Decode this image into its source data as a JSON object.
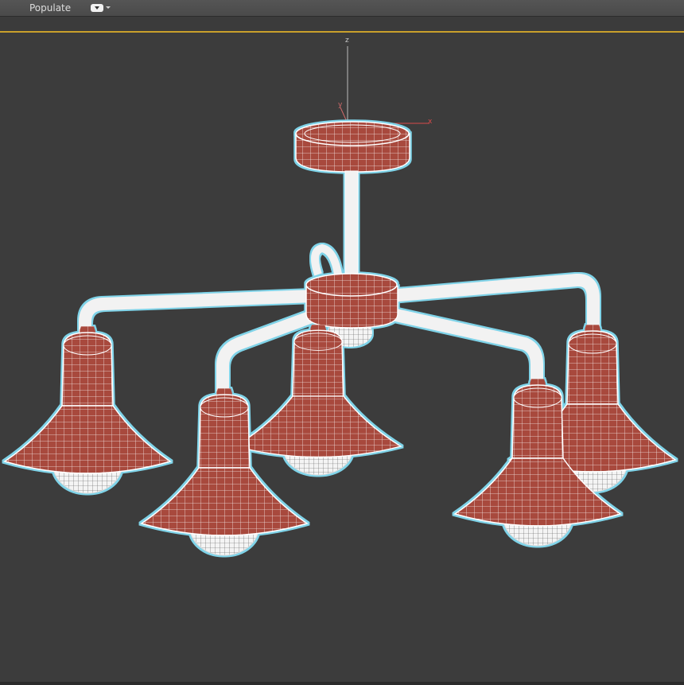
{
  "toolbar": {
    "populate_label": "Populate",
    "dropdown_icon": "dropdown-icon"
  },
  "viewport": {
    "border_color": "#c9a02b",
    "background_color": "#3c3c3c",
    "gizmo": {
      "z_label": "z",
      "y_label": "y",
      "x_label": "x"
    },
    "model": {
      "shade_color": "#a8483e",
      "wire_color": "#ffffff",
      "selection_glow": "#7fd3e8"
    }
  }
}
